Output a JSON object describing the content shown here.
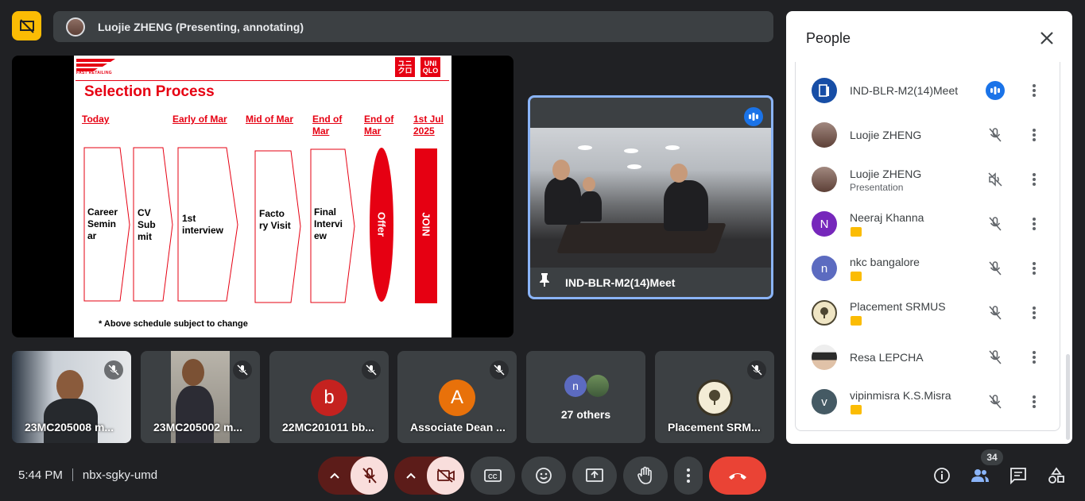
{
  "presenter_bar": {
    "text": "Luojie ZHENG (Presenting, annotating)"
  },
  "slide": {
    "brand_left": "FAST RETAILING",
    "brand_right_top": "UNI",
    "brand_right_bottom": "QLO",
    "title": "Selection Process",
    "stages": [
      {
        "heading": "Today",
        "label": "Career Semin ar"
      },
      {
        "heading": "",
        "label": "CV Sub mit"
      },
      {
        "heading": "Early of Mar",
        "label": "1st interview"
      },
      {
        "heading": "Mid of Mar",
        "label": "Facto ry Visit"
      },
      {
        "heading": "End of Mar",
        "label": "Final Intervi ew"
      },
      {
        "heading": "End of Mar",
        "label": "Offer"
      },
      {
        "heading": "1st Jul 2025",
        "label": "JOIN"
      }
    ],
    "note": "* Above schedule subject to change"
  },
  "feature_tile": {
    "name": "IND-BLR-M2(14)Meet"
  },
  "tiles": [
    {
      "label": "23MC205008 m...",
      "type": "video"
    },
    {
      "label": "23MC205002 m...",
      "type": "video"
    },
    {
      "label": "22MC201011 bb...",
      "type": "avatar",
      "letter": "b",
      "color": "#c5221f"
    },
    {
      "label": "Associate Dean ...",
      "type": "avatar",
      "letter": "A",
      "color": "#e8710a"
    },
    {
      "label": "27 others",
      "type": "others",
      "letter": "n"
    },
    {
      "label": "Placement SRM...",
      "type": "logo"
    }
  ],
  "bottom_bar": {
    "time": "5:44 PM",
    "meeting_code": "nbx-sgky-umd",
    "people_count": "34"
  },
  "people_panel": {
    "title": "People",
    "participants": [
      {
        "name": "IND-BLR-M2(14)Meet",
        "sub": "",
        "avatar_letter": "",
        "avatar_color": "#174ea6",
        "speaking": true
      },
      {
        "name": "Luojie ZHENG",
        "sub": "",
        "avatar_letter": "",
        "avatar_color": "#8d6e63",
        "speaking": false
      },
      {
        "name": "Luojie ZHENG",
        "sub": "Presentation",
        "avatar_letter": "",
        "avatar_color": "#8d6e63",
        "speaking": false
      },
      {
        "name": "Neeraj Khanna",
        "sub": "",
        "avatar_letter": "N",
        "avatar_color": "#7627bb",
        "speaking": false
      },
      {
        "name": "nkc bangalore",
        "sub": "",
        "avatar_letter": "n",
        "avatar_color": "#5c6bc0",
        "speaking": false
      },
      {
        "name": "Placement SRMUS",
        "sub": "",
        "avatar_letter": "",
        "avatar_color": "#e6d9a8",
        "speaking": false
      },
      {
        "name": "Resa LEPCHA",
        "sub": "",
        "avatar_letter": "",
        "avatar_color": "#d7ccc8",
        "speaking": false
      },
      {
        "name": "vipinmisra K.S.Misra",
        "sub": "",
        "avatar_letter": "v",
        "avatar_color": "#455a64",
        "speaking": false
      }
    ]
  }
}
